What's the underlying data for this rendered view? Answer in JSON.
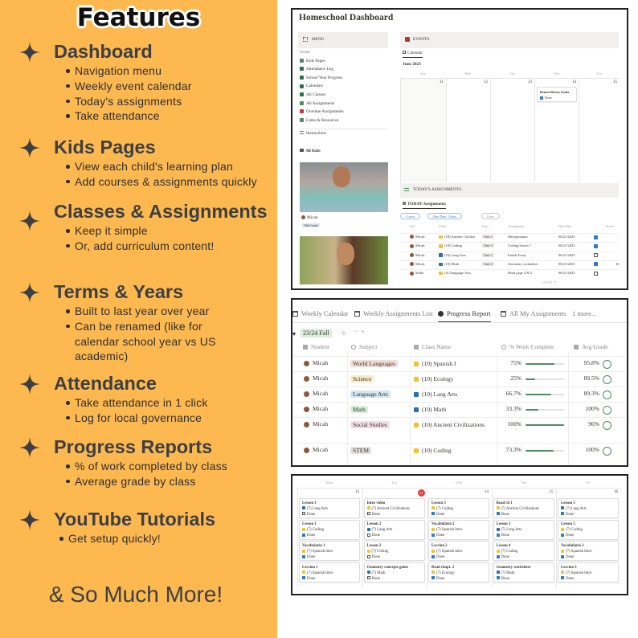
{
  "features": {
    "title": "Features",
    "sections": [
      {
        "heading": "Dashboard",
        "bullets": [
          "Navigation menu",
          "Weekly event calendar",
          "Today's assignments",
          "Take attendance"
        ]
      },
      {
        "heading": "Kids Pages",
        "bullets": [
          "View each child's learning plan",
          "Add courses & assignments quickly"
        ]
      },
      {
        "heading": "Classes & Assignments",
        "bullets": [
          "Keep it simple",
          "Or, add curriculum content!"
        ]
      },
      {
        "heading": "Terms & Years",
        "bullets": [
          "Built to last year over year",
          "Can be renamed (like for calendar school year vs US academic)"
        ]
      },
      {
        "heading": "Attendance",
        "bullets": [
          "Take attendance in 1 click",
          "Log for local governance"
        ]
      },
      {
        "heading": "Progress Reports",
        "bullets": [
          "% of work completed by class",
          "Average grade by class"
        ]
      },
      {
        "heading": "YouTube Tutorials",
        "bullets": [
          "Get setup quickly!"
        ]
      }
    ],
    "more": "& So Much More!",
    "accent": "#fdb84f"
  },
  "dashboard": {
    "title": "Homeschool Dashboard",
    "menu_label": "MENU",
    "menu": [
      {
        "label": "Home",
        "icon": "home-icon"
      },
      {
        "label": "Kids Pages",
        "icon": "people-icon"
      },
      {
        "label": "Attendance Log",
        "icon": "clipboard-icon"
      },
      {
        "label": "School Year Progress",
        "icon": "pie-chart-icon"
      },
      {
        "label": "Calendars",
        "icon": "calendar-icon"
      },
      {
        "label": "All Classes",
        "icon": "book-icon"
      },
      {
        "label": "All Assignments",
        "icon": "checklist-icon"
      },
      {
        "label": "Overdue Assignments",
        "icon": "alert-icon"
      },
      {
        "label": "Links & Resources",
        "icon": "link-icon"
      }
    ],
    "instructions": "Instructions",
    "all_kids": "All Kids",
    "kid": {
      "name": "Micah",
      "grade": "10th Grade"
    },
    "events_label": "EVENTS",
    "calendar_tab": "Calendar",
    "month": "June 2023",
    "days": [
      "Sun",
      "Mon",
      "Tue",
      "Wed",
      "Thu"
    ],
    "dates": [
      "11",
      "12",
      "13",
      "14",
      "15"
    ],
    "event": {
      "title": "Return library books",
      "status": "Done",
      "done": true
    },
    "assign_label": "TODAY'S ASSIGNMENTS",
    "assign_tab": "TODAY Assignments",
    "filters": [
      "4 sorts",
      "Due Date: Today",
      "Done"
    ],
    "columns": [
      "Kid",
      "Class",
      "Unit",
      "Assignment",
      "Due Date",
      "",
      "Score"
    ],
    "rows": [
      {
        "kid": "Micah",
        "class": "(10) Ancient Civiliza",
        "unit": "Unit 1",
        "assignment": "Mesopotamia",
        "due": "06/21/2023",
        "done": true,
        "score": "",
        "folder": "#f2c12e"
      },
      {
        "kid": "Micah",
        "class": "(10) Coding",
        "unit": "Unit 3",
        "assignment": "Coding lesson 7",
        "due": "06/21/2023",
        "done": true,
        "score": "",
        "folder": "#f2c12e"
      },
      {
        "kid": "Micah",
        "class": "(10) Lang Arts",
        "unit": "Unit 1",
        "assignment": "Finish Essay",
        "due": "06/21/2023",
        "done": false,
        "score": "",
        "folder": "#2a6fb5"
      },
      {
        "kid": "Micah",
        "class": "(10) Math",
        "unit": "Unit 2",
        "assignment": "Geometry worksheet",
        "due": "06/21/2023",
        "done": true,
        "score": "10",
        "folder": "#2a6fb5"
      },
      {
        "kid": "Stella",
        "class": "(2) Language Arts",
        "unit": "",
        "assignment": "Read page 4 & 5",
        "due": "06/21/2023",
        "done": false,
        "score": "",
        "folder": "#f2c12e"
      }
    ],
    "count_label": "COUNT",
    "count": "7"
  },
  "progress": {
    "tabs": [
      "Weekly Calendar",
      "Weekly Assignments List",
      "Progress Report",
      "All My Assignments",
      "1 more..."
    ],
    "active_tab": 2,
    "group": "23/24 Fall",
    "group_count": "6",
    "columns": [
      "Student",
      "Subject",
      "Class Name",
      "% Work Complete",
      "Avg Grade"
    ],
    "rows": [
      {
        "student": "Micah",
        "subject": "World Languages",
        "subject_color": "#f3dcd8",
        "class": "(10) Spanish I",
        "folder": "#f2c12e",
        "pct_label": "75%",
        "pct": 75,
        "grade": "95.8%"
      },
      {
        "student": "Micah",
        "subject": "Science",
        "subject_color": "#fbecc8",
        "class": "(10) Ecology",
        "folder": "#f2c12e",
        "pct_label": "25%",
        "pct": 25,
        "grade": "89.5%"
      },
      {
        "student": "Micah",
        "subject": "Language Arts",
        "subject_color": "#d5e6f3",
        "class": "(10) Lang Arts",
        "folder": "#2a6fb5",
        "pct_label": "66.7%",
        "pct": 66.7,
        "grade": "89.3%"
      },
      {
        "student": "Micah",
        "subject": "Math",
        "subject_color": "#dbeddb",
        "class": "(10) Math",
        "folder": "#2a6fb5",
        "pct_label": "33.3%",
        "pct": 33.3,
        "grade": "100%"
      },
      {
        "student": "Micah",
        "subject": "Social Studies",
        "subject_color": "#f5dde8",
        "class": "(10) Ancient Civilizations",
        "folder": "#f2c12e",
        "pct_label": "100%",
        "pct": 100,
        "grade": "96%"
      },
      {
        "student": "Micah",
        "subject": "STEM",
        "subject_color": "#e3e2e0",
        "class": "(10) Coding",
        "folder": "#f2c12e",
        "pct_label": "73.3%",
        "pct": 73.3,
        "grade": "100%"
      }
    ]
  },
  "weekly": {
    "days": [
      "Mon",
      "Tue",
      "Wed",
      "Thu",
      "Fri"
    ],
    "dates": [
      "12",
      "13",
      "14",
      "15",
      "16"
    ],
    "today_index": 1,
    "cards": [
      [
        {
          "t": "Lesson 1",
          "c": "(7) Lang Arts",
          "f": "#2a6fb5",
          "d": false
        },
        {
          "t": "Lesson 1",
          "c": "(7) Coding",
          "f": "#f2c12e",
          "d": true
        },
        {
          "t": "Vocabulario 1",
          "c": "(7) Spanish Intro",
          "f": "#f2c12e",
          "d": true
        },
        {
          "t": "Leccion 1",
          "c": "(7) Spanish Intro",
          "f": "#f2c12e",
          "d": true
        }
      ],
      [
        {
          "t": "Intro video",
          "c": "(7) Ancient Civilizations",
          "f": "#f2c12e",
          "d": false
        },
        {
          "t": "Lesson 2",
          "c": "(7) Lang Arts",
          "f": "#2a6fb5",
          "d": false
        },
        {
          "t": "Lesson 2",
          "c": "(7) Coding",
          "f": "#f2c12e",
          "d": false
        },
        {
          "t": "Geometry concepts game",
          "c": "(7) Math",
          "f": "#2a6fb5",
          "d": false
        }
      ],
      [
        {
          "t": "Lesson 3",
          "c": "(7) Coding",
          "f": "#f2c12e",
          "d": true
        },
        {
          "t": "Vocabulario 2",
          "c": "(7) Spanish Intro",
          "f": "#f2c12e",
          "d": true
        },
        {
          "t": "Leccion 2",
          "c": "(7) Spanish Intro",
          "f": "#f2c12e",
          "d": true
        },
        {
          "t": "Read chapt. 2",
          "c": "(7) Ecology",
          "f": "#f2c12e",
          "d": true
        }
      ],
      [
        {
          "t": "Read ch 1",
          "c": "(7) Ancient Civilizations",
          "f": "#f2c12e",
          "d": true
        },
        {
          "t": "Lesson 3",
          "c": "(7) Lang Arts",
          "f": "#2a6fb5",
          "d": true
        },
        {
          "t": "Lesson 4",
          "c": "(7) Coding",
          "f": "#f2c12e",
          "d": true
        },
        {
          "t": "Geometry worksheet",
          "c": "(7) Math",
          "f": "#2a6fb5",
          "d": true
        }
      ],
      [
        {
          "t": "Lesson 5",
          "c": "(7) Lang Arts",
          "f": "#2a6fb5",
          "d": true
        },
        {
          "t": "Lesson 5",
          "c": "(7) Coding",
          "f": "#f2c12e",
          "d": true
        },
        {
          "t": "Vocabulario 3",
          "c": "(7) Spanish Intro",
          "f": "#f2c12e",
          "d": true
        },
        {
          "t": "Leccion 3",
          "c": "(7) Spanish Intro",
          "f": "#f2c12e",
          "d": true
        }
      ]
    ],
    "done_label": "Done"
  }
}
